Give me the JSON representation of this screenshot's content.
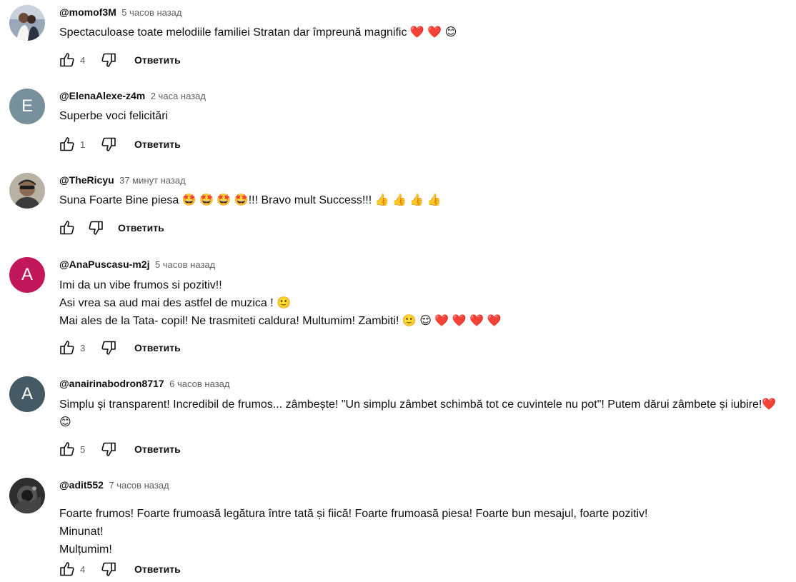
{
  "reply_label": "Ответить",
  "colors": {
    "avatar_e": "#78909c",
    "avatar_a1": "#c2185b",
    "avatar_a2": "#455a64",
    "text": "#0f0f0f",
    "meta": "#606060"
  },
  "comments": [
    {
      "author": "@momof3M",
      "time": "5 часов назад",
      "avatar": "photo",
      "text": "Spectaculoase toate melodiile familiei Stratan dar împreună magnific ❤️ ❤️ 😊",
      "likes": "4"
    },
    {
      "author": "@ElenaAlexe-z4m",
      "time": "2 часа назад",
      "avatar": "E",
      "text": "Superbe voci felicitări",
      "likes": "1"
    },
    {
      "author": "@TheRicyu",
      "time": "37 минут назад",
      "avatar": "photo",
      "text": "Suna Foarte Bine piesa 🤩 🤩 🤩 🤩!!! Bravo mult Success!!! 👍 👍 👍 👍",
      "likes": ""
    },
    {
      "author": "@AnaPuscasu-m2j",
      "time": "5 часов назад",
      "avatar": "A",
      "text": "Imi da un vibe frumos si pozitiv!!\nAsi vrea sa aud mai des astfel de muzica ! 🙂\nMai ales de la Tata- copil! Ne trasmiteti caldura! Multumim! Zambiti! 🙂 😌  ❤️ ❤️ ❤️ ❤️",
      "likes": "3"
    },
    {
      "author": "@anairinabodron8717",
      "time": "6 часов назад",
      "avatar": "A",
      "text": "Simplu și transparent! Incredibil de frumos... zâmbește! \"Un simplu zâmbet schimbă tot ce cuvintele nu pot\"! Putem dărui zâmbete și iubire!❤️ 😊",
      "likes": "5"
    },
    {
      "author": "@adit552",
      "time": "7 часов назад",
      "avatar": "photo",
      "text": "Foarte frumos! Foarte frumoasă legătura între tată și fiică! Foarte frumoasă piesa! Foarte bun mesajul, foarte pozitiv!\nMinunat!\nMulțumim!",
      "likes": "4"
    }
  ]
}
